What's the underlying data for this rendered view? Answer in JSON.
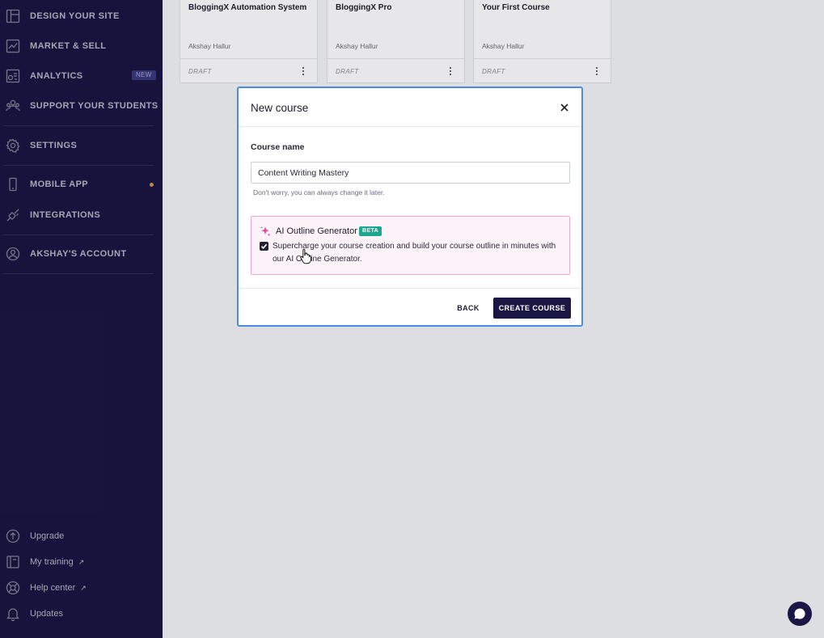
{
  "sidebar": {
    "nav": [
      {
        "label": "DESIGN YOUR SITE",
        "icon": "layout-icon"
      },
      {
        "label": "MARKET & SELL",
        "icon": "chart-line-icon"
      },
      {
        "label": "ANALYTICS",
        "icon": "analytics-icon",
        "badge": "NEW"
      },
      {
        "label": "SUPPORT YOUR STUDENTS",
        "icon": "users-icon"
      },
      {
        "label": "SETTINGS",
        "icon": "gear-icon"
      },
      {
        "label": "MOBILE APP",
        "icon": "phone-icon"
      },
      {
        "label": "INTEGRATIONS",
        "icon": "plug-icon"
      },
      {
        "label": "AKSHAY'S ACCOUNT",
        "icon": "user-circle-icon"
      }
    ],
    "bottom": [
      {
        "label": "Upgrade",
        "icon": "arrow-up-circle-icon"
      },
      {
        "label": "My training",
        "icon": "book-icon"
      },
      {
        "label": "Help center",
        "icon": "lifebuoy-icon"
      },
      {
        "label": "Updates",
        "icon": "bell-icon"
      }
    ],
    "colors": {
      "background": "#1a1744",
      "text": "#c9c8d6",
      "dot": "#d4b04a"
    }
  },
  "courses": [
    {
      "title": "BloggingX Automation System",
      "author": "Akshay Hallur",
      "status": "DRAFT"
    },
    {
      "title": "BloggingX Pro",
      "author": "Akshay Hallur",
      "status": "DRAFT"
    },
    {
      "title": "Your First Course",
      "author": "Akshay Hallur",
      "status": "DRAFT"
    }
  ],
  "modal": {
    "title": "New course",
    "field_label": "Course name",
    "course_name_value": "Content Writing Mastery",
    "hint": "Don't worry, you can always change it later.",
    "ai": {
      "title": "AI Outline Generator",
      "badge": "BETA",
      "checked": true,
      "description": "Supercharge your course creation and build your course outline in minutes with our AI Outline Generator."
    },
    "back_label": "BACK",
    "create_label": "CREATE COURSE",
    "colors": {
      "primary": "#1a1744",
      "beta": "#1aa690",
      "ai_bg": "#fdf3f9",
      "ai_border": "#eaa9cf",
      "focus_border": "#4f8bdc"
    }
  },
  "chat": {
    "icon": "chat-bubble-icon"
  }
}
